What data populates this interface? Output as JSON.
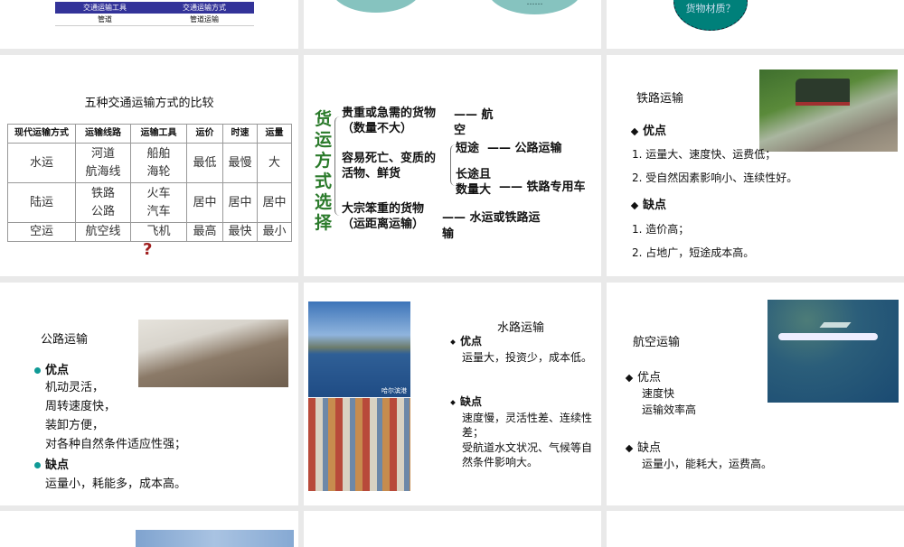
{
  "slide1": {
    "table_headers": [
      "交通运输工具",
      "交通运输方式"
    ],
    "row": [
      "管道",
      "管道运输"
    ],
    "header_color": "#333399"
  },
  "slide2": {
    "bubble_text": "……"
  },
  "slide3": {
    "bubble_text": "货物材质？"
  },
  "slide4": {
    "title": "五种交通运输方式的比较",
    "headers": [
      "现代运输方式",
      "运输线路",
      "运输工具",
      "运价",
      "时速",
      "运量"
    ],
    "rows": [
      [
        "水运",
        "河道\n航海线",
        "船舶\n海轮",
        "最低",
        "最慢",
        "大"
      ],
      [
        "陆运",
        "铁路\n公路",
        "火车\n汽车",
        "居中",
        "居中",
        "居中"
      ],
      [
        "空运",
        "航空线",
        "飞机",
        "最高",
        "最快",
        "最小"
      ]
    ],
    "question_mark": "?"
  },
  "slide5": {
    "side_title": "货运方式选择",
    "b1": "贵重或急需的货物",
    "b1b": "（数量不大）",
    "r1": "—— 航",
    "r1b": "空",
    "b2": "容易死亡、变质的",
    "b2b": "活物、鲜货",
    "s1": "短途",
    "r2": "—— 公路运输",
    "s2": "长途且",
    "s2b": "数量大",
    "r3": "—— 铁路专用车",
    "b3": "大宗笨重的货物",
    "b3b": "（运距离运输）",
    "r4": "—— 水运或铁路运",
    "r4b": "输"
  },
  "slide6": {
    "title": "铁路运输",
    "pros_label": "优点",
    "pros": [
      "1. 运量大、速度快、运费低；",
      "2. 受自然因素影响小、连续性好。"
    ],
    "cons_label": "缺点",
    "cons": [
      "1. 造价高；",
      "2. 占地广，短途成本高。"
    ]
  },
  "slide7": {
    "title": "公路运输",
    "pros_label": "优点",
    "pros": [
      "机动灵活，",
      "周转速度快，",
      "装卸方便，",
      "对各种自然条件适应性强；"
    ],
    "cons_label": "缺点",
    "cons": [
      "运量小，耗能多，成本高。"
    ]
  },
  "slide8": {
    "title": "水路运输",
    "photo_caption": "哈尔滨港",
    "pros_label": "优点",
    "pros": [
      "运量大，投资少，成本低。"
    ],
    "cons_label": "缺点",
    "cons": [
      "速度慢，灵活性差、连续性差；",
      "受航道水文状况、气候等自然条件影响大。"
    ]
  },
  "slide9": {
    "title": "航空运输",
    "pros_label": "优点",
    "pros": [
      "速度快",
      "运输效率高"
    ],
    "cons_label": "缺点",
    "cons": [
      "运量小，能耗大，运费高。"
    ]
  }
}
